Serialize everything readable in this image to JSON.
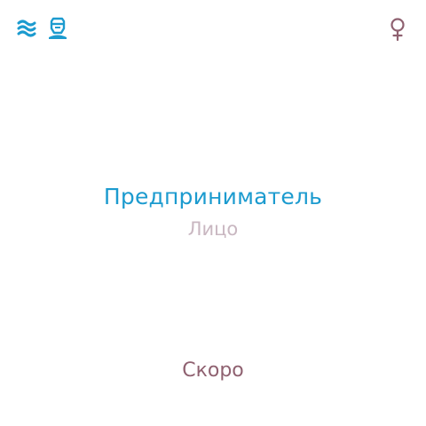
{
  "header": {
    "menu_icon": "waves-menu-icon",
    "avatar_icon": "bearded-man-icon",
    "gender_icon": "female-symbol-icon"
  },
  "main": {
    "title": "Предприниматель",
    "subtitle": "Лицо"
  },
  "footer": {
    "status": "Скоро"
  },
  "colors": {
    "accent_blue": "#1c9bcf",
    "muted_pink": "#c9b7c1",
    "mauve": "#8f6170"
  }
}
